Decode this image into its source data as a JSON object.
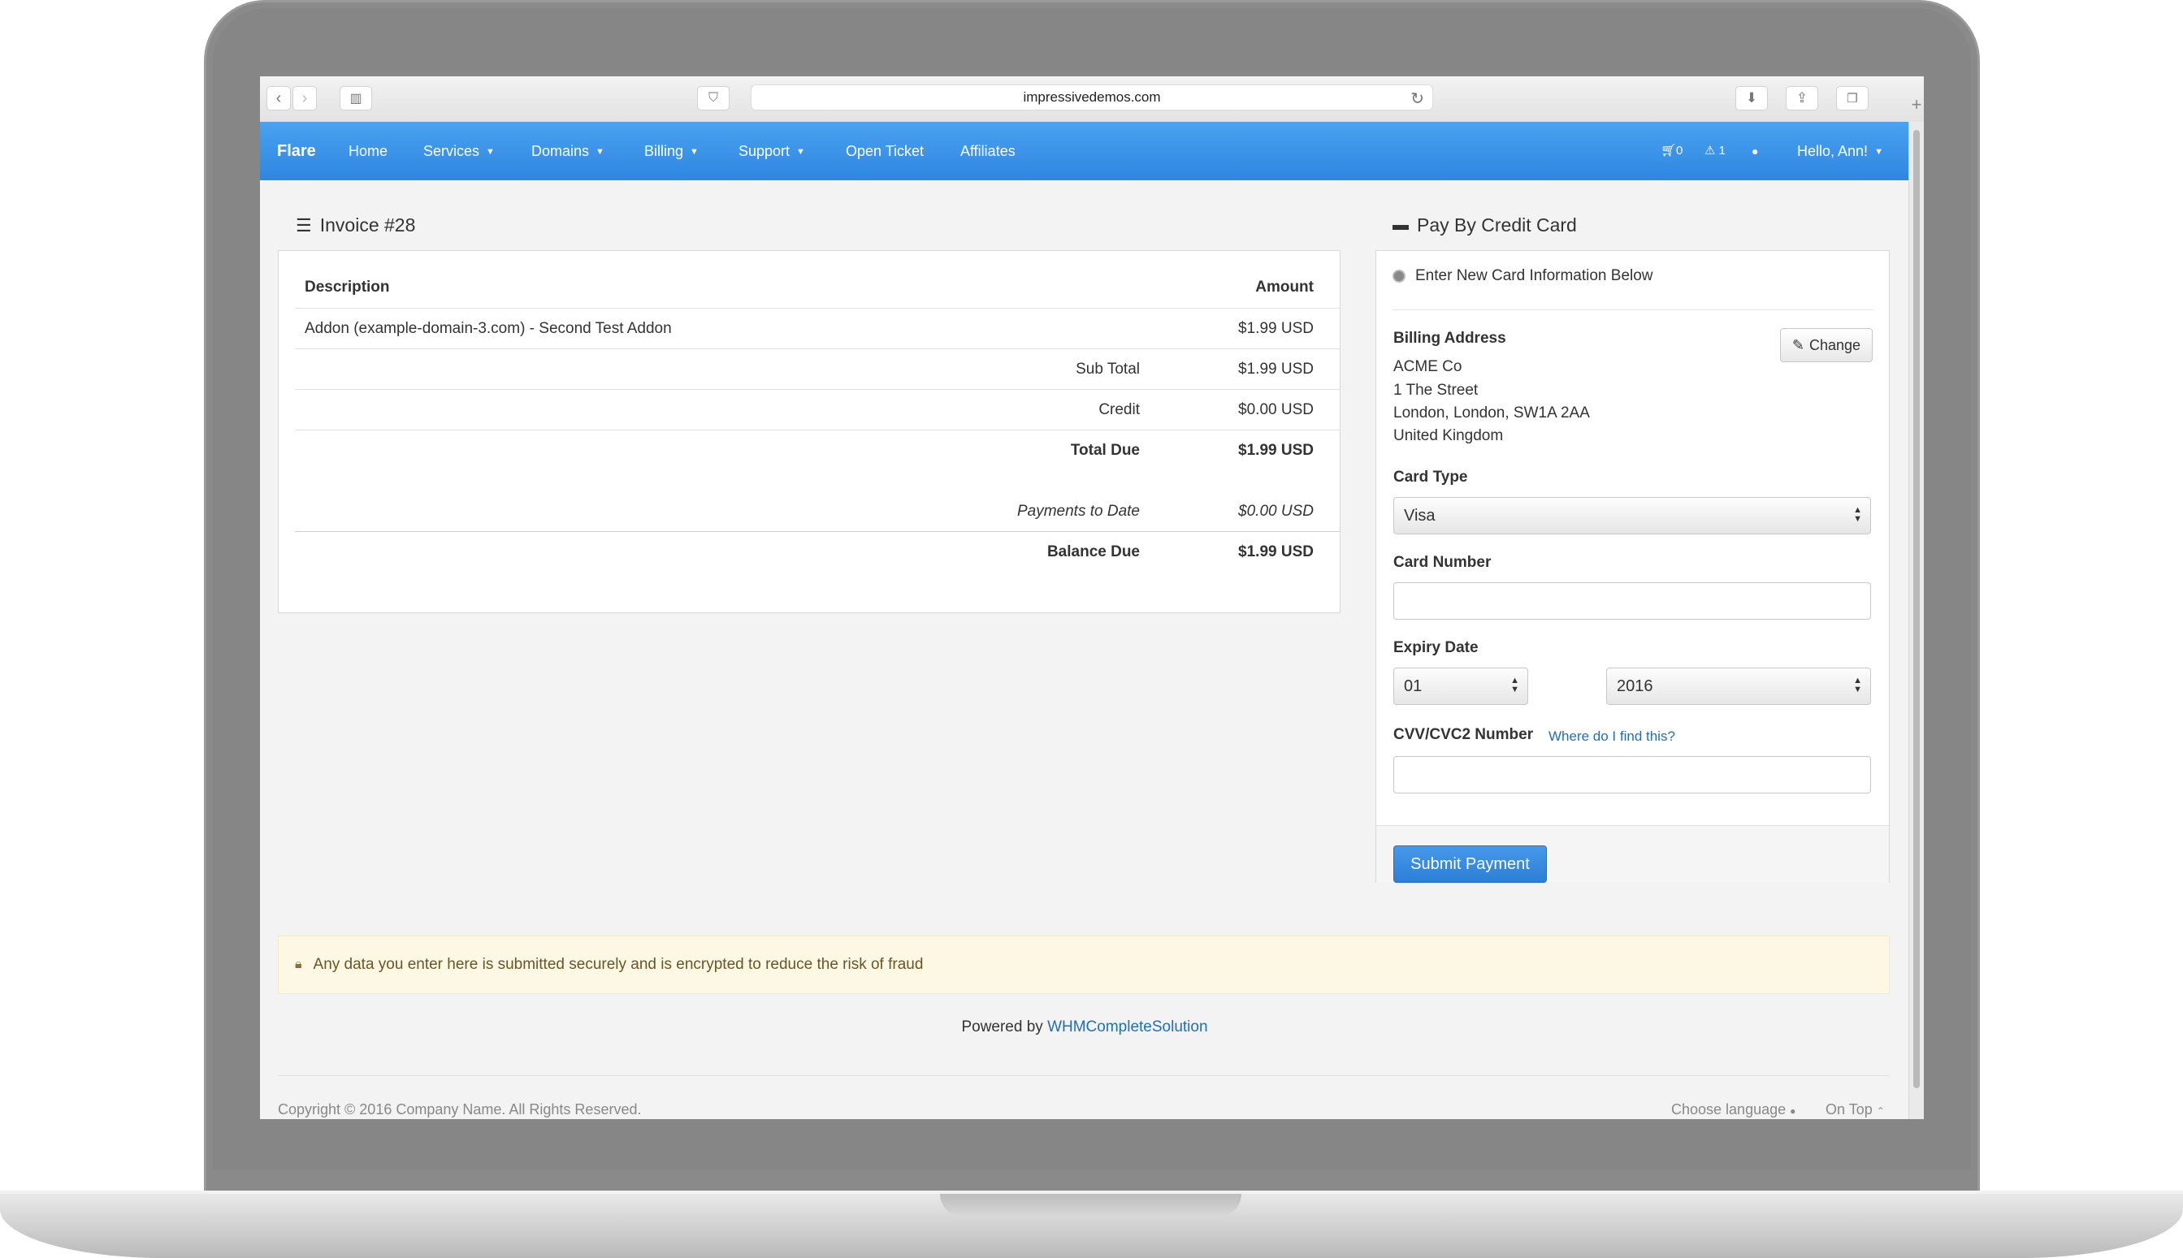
{
  "browser": {
    "url": "impressivedemos.com"
  },
  "navbar": {
    "brand": "Flare",
    "items": [
      {
        "label": "Home",
        "dropdown": false
      },
      {
        "label": "Services",
        "dropdown": true
      },
      {
        "label": "Domains",
        "dropdown": true
      },
      {
        "label": "Billing",
        "dropdown": true
      },
      {
        "label": "Support",
        "dropdown": true
      },
      {
        "label": "Open Ticket",
        "dropdown": false
      },
      {
        "label": "Affiliates",
        "dropdown": false
      }
    ],
    "cart_count": "0",
    "alert_count": "1",
    "user_greeting": "Hello, Ann!"
  },
  "invoice": {
    "title": "Invoice #28",
    "columns": {
      "description": "Description",
      "amount": "Amount"
    },
    "line_items": [
      {
        "description": "Addon (example-domain-3.com) - Second Test Addon",
        "amount": "$1.99 USD"
      }
    ],
    "sub_total": {
      "label": "Sub Total",
      "value": "$1.99 USD"
    },
    "credit": {
      "label": "Credit",
      "value": "$0.00 USD"
    },
    "total_due": {
      "label": "Total Due",
      "value": "$1.99 USD"
    },
    "payments_to_date": {
      "label": "Payments to Date",
      "value": "$0.00 USD"
    },
    "balance_due": {
      "label": "Balance Due",
      "value": "$1.99 USD"
    }
  },
  "payment": {
    "title": "Pay By Credit Card",
    "new_card_option": "Enter New Card Information Below",
    "billing_address_label": "Billing Address",
    "change_label": "Change",
    "address_lines": [
      "ACME Co",
      "1 The Street",
      "London, London, SW1A 2AA",
      "United Kingdom"
    ],
    "card_type_label": "Card Type",
    "card_type_value": "Visa",
    "card_number_label": "Card Number",
    "card_number_value": "",
    "expiry_label": "Expiry Date",
    "expiry_month": "01",
    "expiry_year": "2016",
    "cvv_label": "CVV/CVC2 Number",
    "cvv_help_link": "Where do I find this?",
    "cvv_value": "",
    "submit_label": "Submit Payment"
  },
  "security_notice": "Any data you enter here is submitted securely and is encrypted to reduce the risk of fraud",
  "footer": {
    "powered_by": "Powered by",
    "powered_link": "WHMCompleteSolution",
    "copyright": "Copyright © 2016 Company Name. All Rights Reserved.",
    "choose_language": "Choose language",
    "on_top": "On Top"
  },
  "colors": {
    "nav_blue": "#3a93e8",
    "button_blue": "#2f86e0",
    "link_blue": "#1f6fb5",
    "notice_bg": "#fcf8e3"
  }
}
